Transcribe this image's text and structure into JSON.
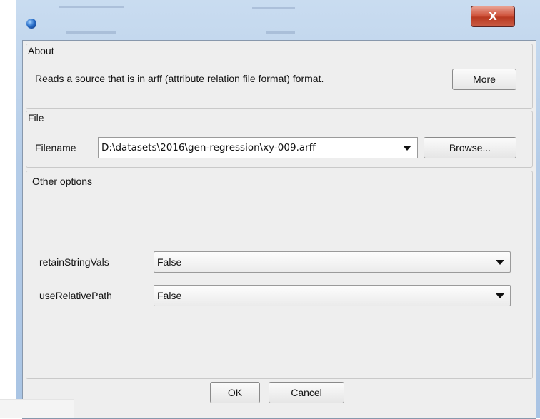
{
  "window": {
    "close_glyph": "X",
    "icon": "java-cup-icon"
  },
  "about": {
    "legend": "About",
    "description": "Reads a source that is in arff (attribute relation file format) format.",
    "more_label": "More"
  },
  "file": {
    "legend": "File",
    "filename_label": "Filename",
    "filename_value": "D:\\datasets\\2016\\gen-regression\\xy-009.arff",
    "browse_label": "Browse..."
  },
  "other_options": {
    "legend": "Other options",
    "options": [
      {
        "name": "retainStringVals",
        "value": "False"
      },
      {
        "name": "useRelativePath",
        "value": "False"
      }
    ]
  },
  "footer": {
    "ok_label": "OK",
    "cancel_label": "Cancel"
  }
}
